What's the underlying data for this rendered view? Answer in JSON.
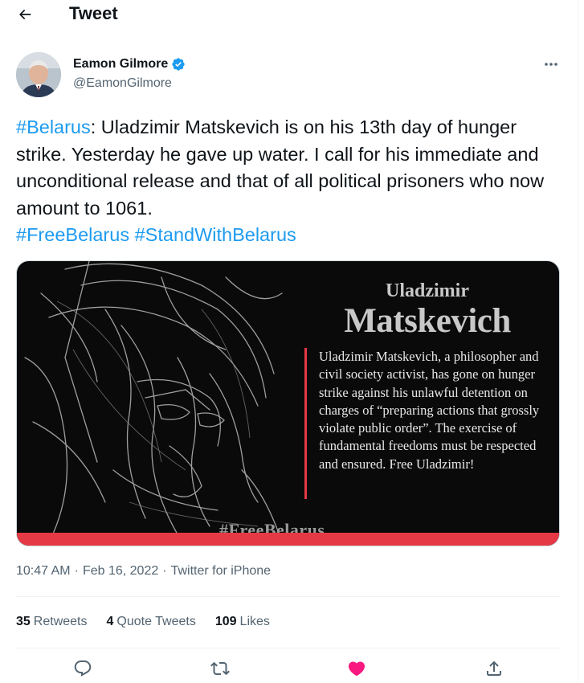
{
  "header": {
    "title": "Tweet",
    "back_icon": "arrow-left-icon"
  },
  "author": {
    "name": "Eamon Gilmore",
    "handle": "@EamonGilmore",
    "verified": true,
    "verified_color": "#1d9bf0"
  },
  "tweet": {
    "segments": [
      {
        "type": "hashtag",
        "text": "#Belarus"
      },
      {
        "type": "text",
        "text": ": Uladzimir Matskevich is on his 13th day of hunger strike. Yesterday he gave up water. I call for his immediate and unconditional release and that of all political prisoners who now amount to 1061."
      },
      {
        "type": "break",
        "text": ""
      },
      {
        "type": "hashtag",
        "text": "#FreeBelarus"
      },
      {
        "type": "text",
        "text": " "
      },
      {
        "type": "hashtag",
        "text": "#StandWithBelarus"
      }
    ],
    "link_color": "#1d9bf0"
  },
  "media": {
    "title_small": "Uladzimir",
    "title_big": "Matskevich",
    "description": "Uladzimir Matskevich, a philosopher and civil society activist, has gone on hunger strike against his unlawful detention on charges of “preparing actions that grossly violate public order”. The exercise of fundamental freedoms must be respected and ensured. Free Uladzimir!",
    "hashtag": "#FreeBelarus",
    "accent_color": "#e63946"
  },
  "meta": {
    "time": "10:47 AM",
    "separator": "·",
    "date": "Feb 16, 2022",
    "source": "Twitter for iPhone"
  },
  "stats": {
    "retweets": {
      "count": "35",
      "label": "Retweets"
    },
    "quotes": {
      "count": "4",
      "label": "Quote Tweets"
    },
    "likes": {
      "count": "109",
      "label": "Likes"
    }
  },
  "actions": {
    "reply_icon": "reply-icon",
    "retweet_icon": "retweet-icon",
    "like_icon": "heart-icon",
    "like_color": "#f91880",
    "share_icon": "share-icon"
  }
}
